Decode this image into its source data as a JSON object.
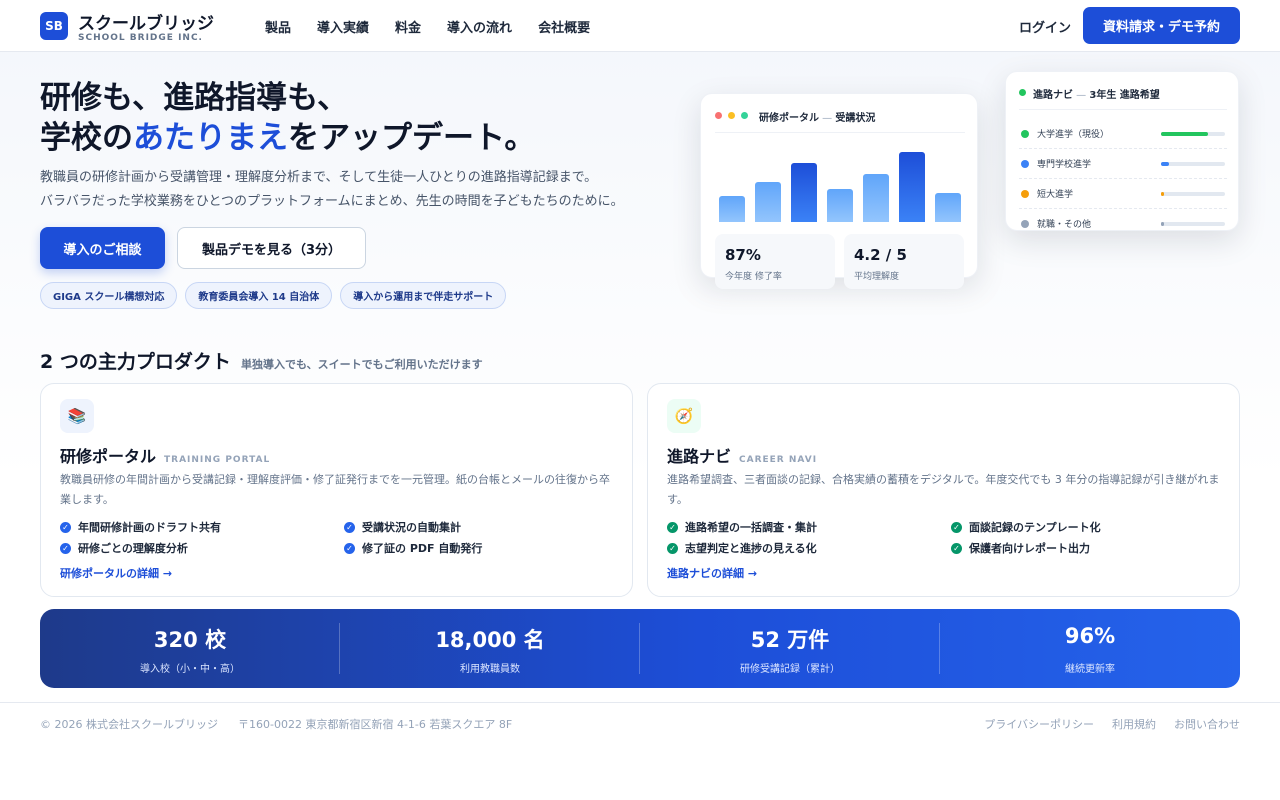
{
  "header": {
    "logo_mark": "SB",
    "logo_name": "スクールブリッジ",
    "logo_sub": "SCHOOL BRIDGE INC.",
    "nav": [
      {
        "label": "製品"
      },
      {
        "label": "導入実績"
      },
      {
        "label": "料金"
      },
      {
        "label": "導入の流れ"
      },
      {
        "label": "会社概要"
      }
    ],
    "login_label": "ログイン",
    "cta_label": "資料請求・デモ予約"
  },
  "hero": {
    "title_line1": "研修も、進路指導も、",
    "title_pre": "学校の",
    "title_accent": "あたりまえ",
    "title_post": "をアップデート。",
    "desc_line1": "教職員の研修計画から受講管理・理解度分析まで、そして生徒一人ひとりの進路指導記録まで。",
    "desc_line2": "バラバラだった学校業務をひとつのプラットフォームにまとめ、先生の時間を子どもたちのために。",
    "primary_button": "導入のご相談",
    "secondary_button": "製品デモを見る（3分）",
    "badges": [
      {
        "label": "GIGA スクール構想対応"
      },
      {
        "label": "教育委員会導入 14 自治体"
      },
      {
        "label": "導入から運用まで伴走サポート"
      }
    ]
  },
  "mock_portal": {
    "title": "研修ポータル",
    "title_sep": " — ",
    "subtitle": "受講状況",
    "bars": [
      0.33,
      0.5,
      0.74,
      0.41,
      0.6,
      0.88,
      0.36
    ],
    "dark_bars": [
      2,
      5
    ],
    "kpis": [
      {
        "value": "87%",
        "label": "今年度 修了率"
      },
      {
        "value": "4.2 / 5",
        "label": "平均理解度"
      }
    ]
  },
  "mock_navi": {
    "title": "進路ナビ",
    "title_sep": " — ",
    "subtitle": "3年生 進路希望",
    "rows": [
      {
        "label": "大学進学（現役）",
        "color": "#22c55e",
        "fill": 0.74
      },
      {
        "label": "専門学校進学",
        "color": "#3b82f6",
        "fill": 0.12
      },
      {
        "label": "短大進学",
        "color": "#f59e0b",
        "fill": 0.05
      },
      {
        "label": "就職・その他",
        "color": "#94a3b8",
        "fill": 0.05
      }
    ]
  },
  "products": {
    "title": "2 つの主力プロダクト",
    "subtitle": "単独導入でも、スイートでもご利用いただけます",
    "cards": [
      {
        "icon": "📚",
        "name": "研修ポータル",
        "en": "TRAINING PORTAL",
        "desc": "教職員研修の年間計画から受講記録・理解度評価・修了証発行までを一元管理。紙の台帳とメールの往復から卒業します。",
        "features": [
          "年間研修計画のドラフト共有",
          "受講状況の自動集計",
          "研修ごとの理解度分析",
          "修了証の PDF 自動発行"
        ],
        "link": "研修ポータルの詳細 →",
        "accent": "#2563eb",
        "icon_bg": "#eef3fd"
      },
      {
        "icon": "🧭",
        "name": "進路ナビ",
        "en": "CAREER NAVI",
        "desc": "進路希望調査、三者面談の記録、合格実績の蓄積をデジタルで。年度交代でも 3 年分の指導記録が引き継がれます。",
        "features": [
          "進路希望の一括調査・集計",
          "面談記録のテンプレート化",
          "志望判定と進捗の見える化",
          "保護者向けレポート出力"
        ],
        "link": "進路ナビの詳細 →",
        "accent": "#059669",
        "icon_bg": "#ecfdf5"
      }
    ]
  },
  "stats": [
    {
      "value": "320 校",
      "label": "導入校（小・中・高）"
    },
    {
      "value": "18,000 名",
      "label": "利用教職員数"
    },
    {
      "value": "52 万件",
      "label": "研修受講記録（累計）"
    },
    {
      "value": "96%",
      "label": "継続更新率"
    }
  ],
  "footer": {
    "copyright": "© 2026 株式会社スクールブリッジ",
    "address": "〒160-0022 東京都新宿区新宿 4-1-6 若葉スクエア 8F",
    "links": [
      {
        "label": "プライバシーポリシー"
      },
      {
        "label": "利用規約"
      },
      {
        "label": "お問い合わせ"
      }
    ]
  },
  "colors": {
    "brand": "#1d4ed8",
    "accent_green": "#22c55e"
  }
}
